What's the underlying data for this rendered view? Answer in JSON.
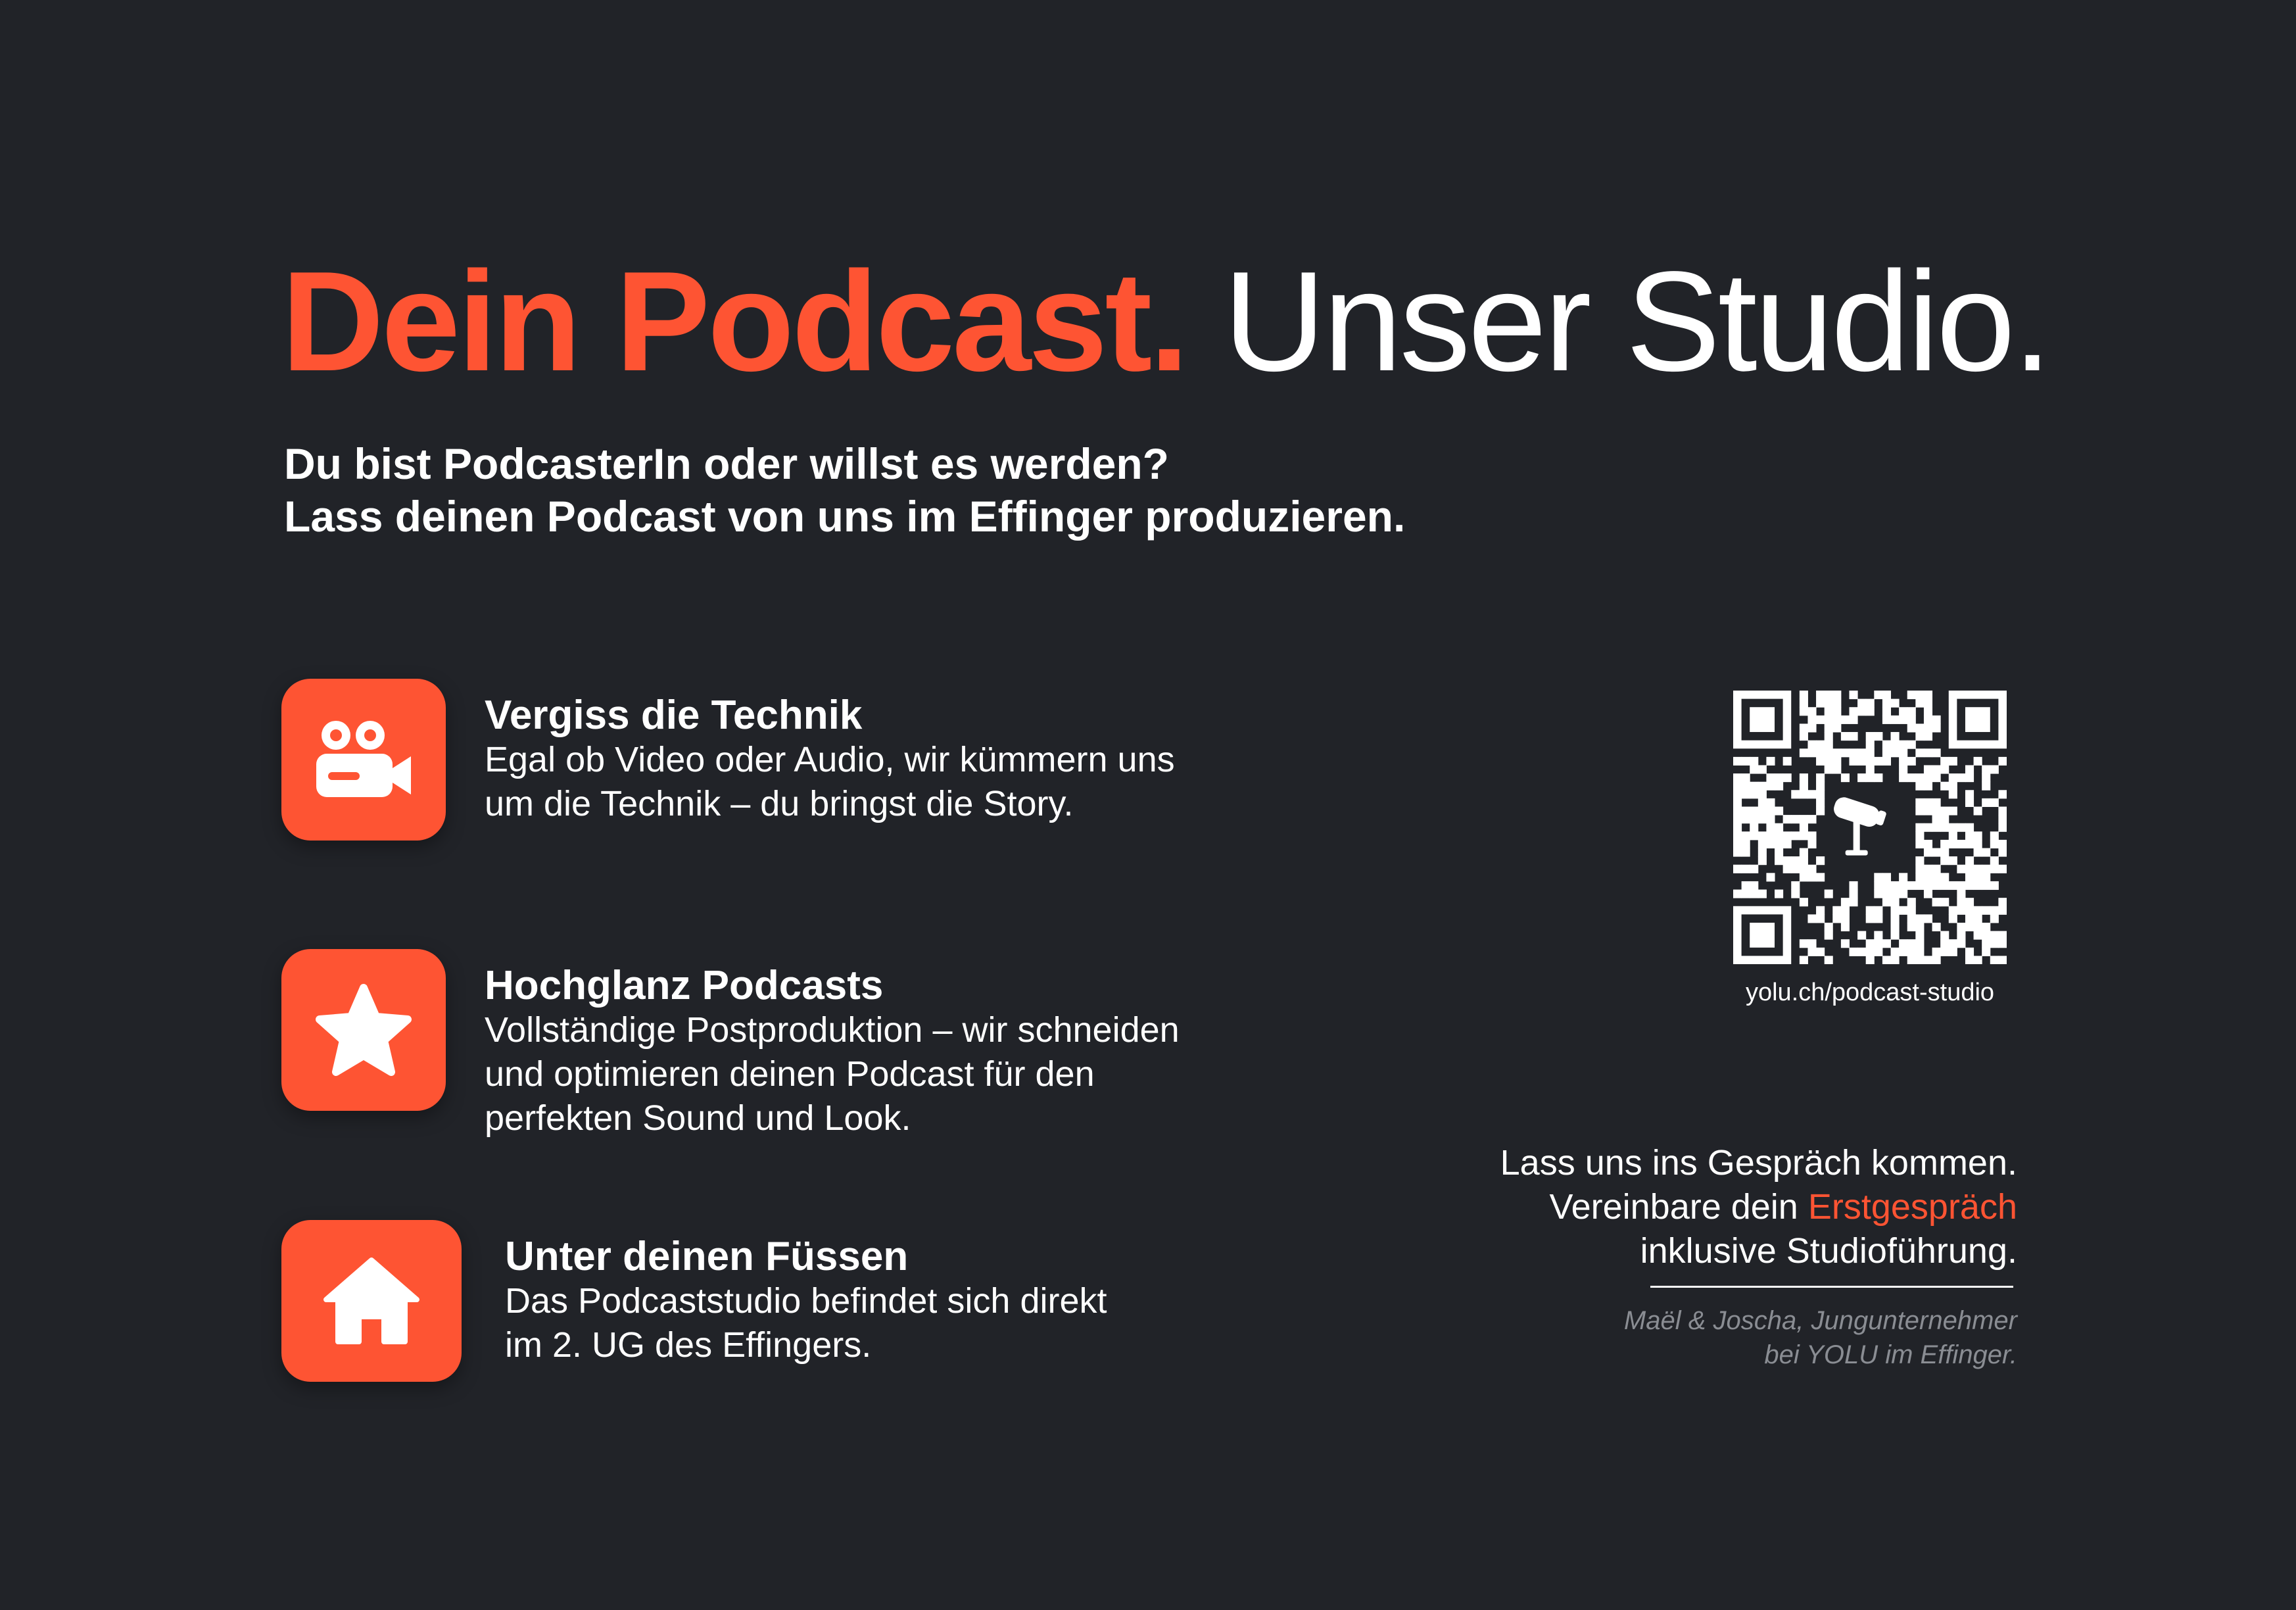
{
  "headline": {
    "accent": "Dein Podcast.",
    "rest": "Unser Studio."
  },
  "intro": {
    "line1": "Du bist PodcasterIn oder willst es werden?",
    "line2": "Lass deinen Podcast von uns im Effinger produzieren."
  },
  "features": [
    {
      "icon": "video-camera-icon",
      "title": "Vergiss die Technik",
      "lines": [
        "Egal ob Video oder Audio, wir kümmern uns",
        "um die Technik  – du bringst die Story."
      ]
    },
    {
      "icon": "star-icon",
      "title": "Hochglanz Podcasts",
      "lines": [
        "Vollständige Postproduktion – wir schneiden",
        "und optimieren deinen Podcast für den",
        "perfekten Sound und Look."
      ]
    },
    {
      "icon": "house-icon",
      "title": "Unter deinen Füssen",
      "lines": [
        "Das Podcaststudio befindet sich direkt",
        "im 2. UG des Effingers."
      ]
    }
  ],
  "qr": {
    "url_label": "yolu.ch/podcast-studio",
    "center_icon": "microphone-icon"
  },
  "cta": {
    "line1": "Lass uns ins Gespräch kommen.",
    "line2_prefix": "Vereinbare dein ",
    "line2_highlight": "Erstgespräch",
    "line3": "inklusive Studioführung."
  },
  "signature": {
    "line1": "Maël & Joscha, Jungunternehmer",
    "line2": "bei YOLU im Effinger."
  },
  "colors": {
    "background": "#212328",
    "accent": "#fe5433",
    "text": "#ffffff",
    "muted": "#8a8d93"
  }
}
